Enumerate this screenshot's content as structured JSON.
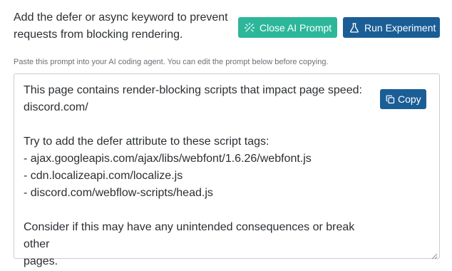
{
  "header": {
    "description": "Add the defer or async keyword to prevent requests from blocking rendering."
  },
  "toolbar": {
    "close_ai_prompt_label": "Close AI Prompt",
    "run_experiment_label": "Run Experiment"
  },
  "hint": "Paste this prompt into your AI coding agent. You can edit the prompt below before copying.",
  "prompt": {
    "text": "This page contains render-blocking scripts that impact page speed:\ndiscord.com/\n\nTry to add the defer attribute to these script tags:\n- ajax.googleapis.com/ajax/libs/webfont/1.6.26/webfont.js\n- cdn.localizeapi.com/localize.js\n- discord.com/webflow-scripts/head.js\n\nConsider if this may have any unintended consequences or break other\npages.",
    "copy_label": "Copy"
  },
  "colors": {
    "close_button": "#2db79a",
    "primary_button": "#1b5e96",
    "text": "#2b2f33",
    "hint_text": "#6b6f74",
    "border": "#c9cdd1"
  },
  "icons": {
    "close_ai_prompt": "sparkle-icon",
    "run_experiment": "flask-icon",
    "copy": "copy-icon"
  }
}
